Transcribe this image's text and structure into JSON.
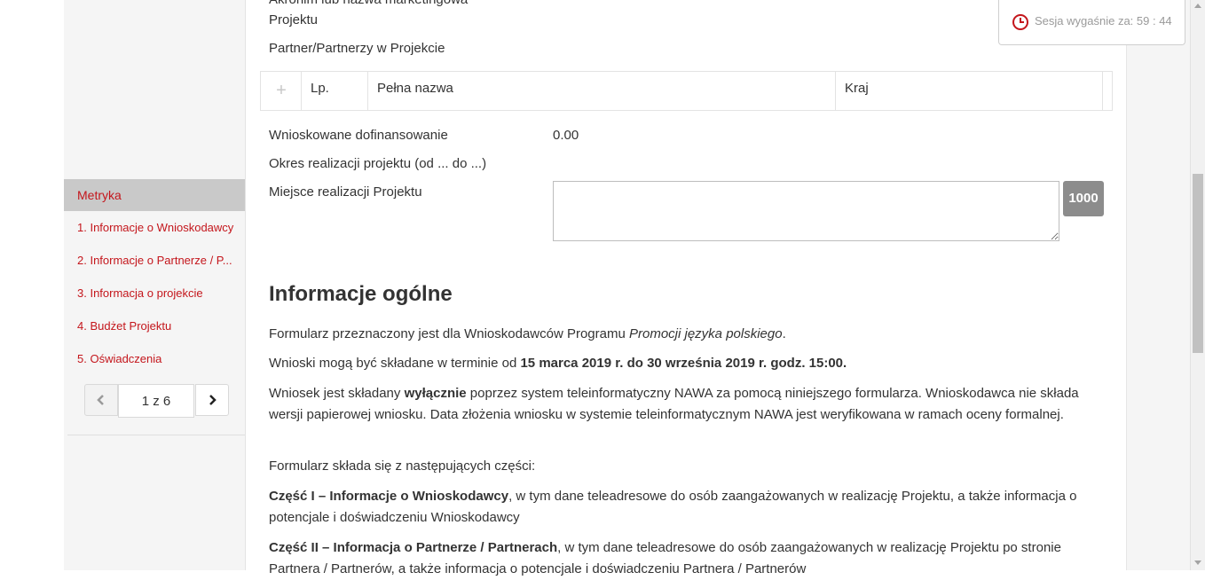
{
  "session": {
    "label": "Sesja wygaśnie za:",
    "time": "59 : 44"
  },
  "sidebar": {
    "items": [
      {
        "label": "Metryka",
        "active": true
      },
      {
        "label": "1. Informacje o Wnioskodawcy"
      },
      {
        "label": "2. Informacje o Partnerze / P..."
      },
      {
        "label": "3. Informacja o projekcie"
      },
      {
        "label": "4. Budżet Projektu"
      },
      {
        "label": "5. Oświadczenia"
      }
    ],
    "pager": {
      "indicator": "1 z 6",
      "prev_icon": "chevron-left-icon",
      "next_icon": "chevron-right-icon"
    }
  },
  "form": {
    "cut_label": "Akronim lub nazwa marketingowa",
    "cut_label_2": "Projektu",
    "partners_label": "Partner/Partnerzy w Projekcie",
    "table": {
      "add_icon": "plus-icon",
      "headers": [
        "Lp.",
        "Pełna nazwa",
        "Kraj"
      ]
    },
    "funding_label": "Wnioskowane dofinansowanie",
    "funding_value": "0.00",
    "period_label": "Okres realizacji projektu (od ... do ...)",
    "place_label": "Miejsce realizacji Projektu",
    "place_value": "",
    "char_counter": "1000"
  },
  "info": {
    "heading": "Informacje ogólne",
    "p1_a": "Formularz przeznaczony jest dla Wnioskodawców Programu ",
    "p1_b": "Promocji języka polskiego",
    "p1_c": ".",
    "p2_a": "Wnioski mogą być składane w terminie od ",
    "p2_b": "15 marca 2019 r. do 30 września 2019 r. godz. 15:00.",
    "p3_a": "Wniosek jest składany ",
    "p3_b": "wyłącznie",
    "p3_c": " poprzez system teleinformatyczny NAWA za pomocą niniejszego formularza. Wnioskodawca nie składa wersji papierowej wniosku. Data złożenia wniosku w systemie teleinformatycznym NAWA jest weryfikowana w ramach oceny formalnej.",
    "p4": "Formularz składa się z następujących części:",
    "p5_a": "Część I – Informacje o Wnioskodawcy",
    "p5_b": ", w tym dane teleadresowe do osób zaangażowanych w realizację Projektu, a także informacja o potencjale i doświadczeniu Wnioskodawcy",
    "p6_a": "Część II – Informacja o Partnerze / Partnerach",
    "p6_b": ", w tym dane teleadresowe do osób zaangażowanych w realizację Projektu po stronie Partnera / Partnerów, a także informacja o potencjale i doświadczeniu Partnera / Partnerów"
  },
  "colors": {
    "accent": "#c4161c",
    "sidebar_bg": "#f5f5f5",
    "active_item_bg": "#c9c9c9",
    "counter_bg": "#8c8c8c"
  }
}
